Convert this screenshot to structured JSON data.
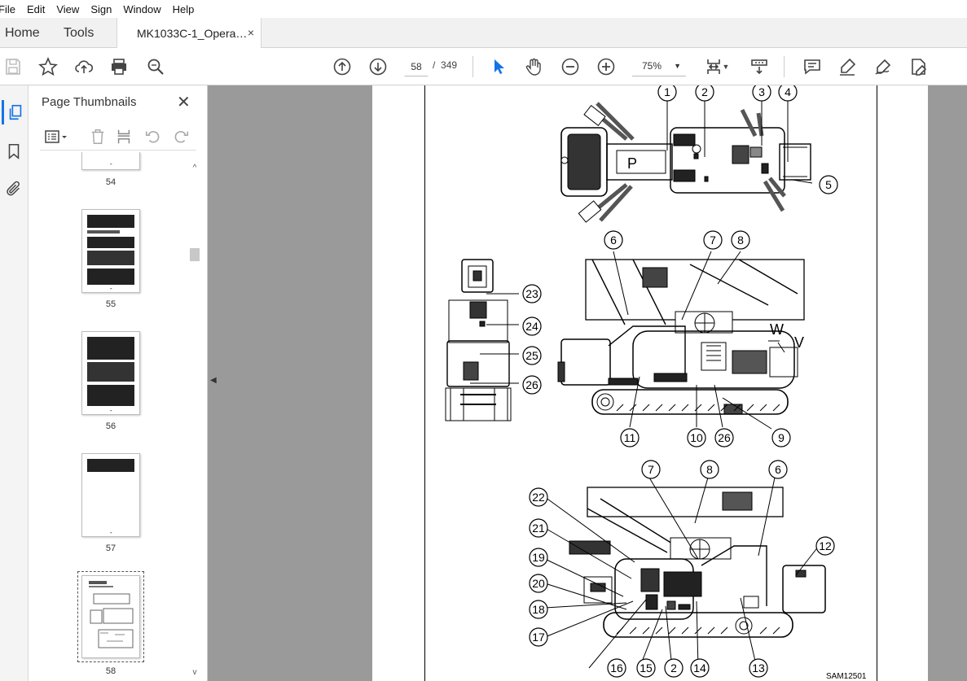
{
  "menu": [
    "File",
    "Edit",
    "View",
    "Sign",
    "Window",
    "Help"
  ],
  "tabs": {
    "home": "Home",
    "tools": "Tools",
    "document": "MK1033C-1_Opera…",
    "close": "×"
  },
  "toolbar": {
    "page_current": "58",
    "page_separator": "/",
    "page_total": "349",
    "zoom": "75%",
    "icons": [
      "save-icon",
      "bookmark-star-icon",
      "upload-cloud-icon",
      "print-icon",
      "zoom-search-icon",
      "prev-page-icon",
      "next-page-icon",
      "select-cursor-icon",
      "hand-icon",
      "zoom-out-icon",
      "zoom-in-icon",
      "fit-page-icon",
      "scroll-mode-icon",
      "comment-icon",
      "highlight-icon",
      "sign-icon",
      "fill-sign-icon"
    ]
  },
  "panel": {
    "title": "Page Thumbnails",
    "close": "✕"
  },
  "thumbnails": [
    {
      "label": "54"
    },
    {
      "label": "55"
    },
    {
      "label": "56"
    },
    {
      "label": "57"
    },
    {
      "label": "58",
      "selected": true
    }
  ],
  "page_footer_mark": "-",
  "document": {
    "callouts": [
      "1",
      "2",
      "3",
      "4",
      "5",
      "6",
      "7",
      "8",
      "23",
      "24",
      "25",
      "26",
      "11",
      "10",
      "26",
      "9",
      "7",
      "8",
      "6",
      "22",
      "21",
      "12",
      "19",
      "20",
      "18",
      "17",
      "16",
      "15",
      "2",
      "14",
      "13"
    ],
    "letters": [
      "P",
      "W",
      "V"
    ],
    "figure_code": "SAM12501"
  },
  "colors": {
    "accent": "#1473e6",
    "doc_bg": "#9a9a9a"
  }
}
